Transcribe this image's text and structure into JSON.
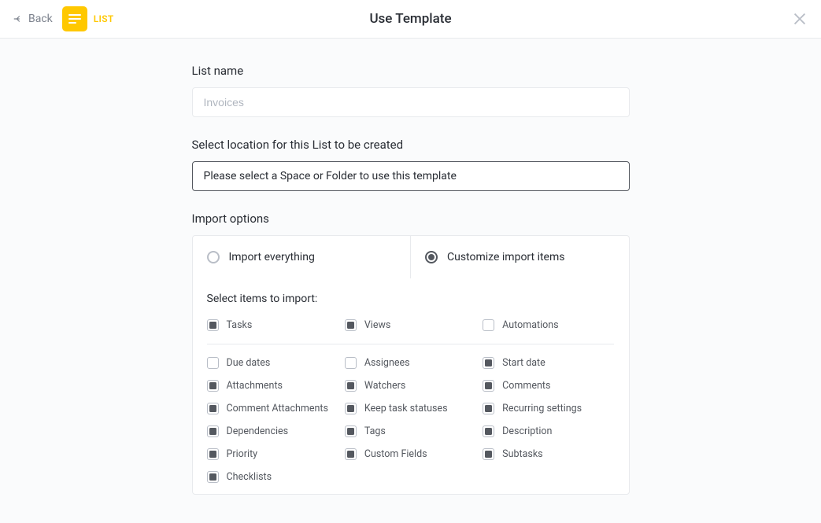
{
  "header": {
    "back_label": "Back",
    "list_label": "LIST",
    "title": "Use Template"
  },
  "list_name": {
    "label": "List name",
    "placeholder": "Invoices",
    "value": ""
  },
  "location": {
    "label": "Select location for this List to be created",
    "placeholder": "Please select a Space or Folder to use this template"
  },
  "import": {
    "label": "Import options",
    "tabs": {
      "everything": "Import everything",
      "customize": "Customize import items"
    },
    "selected_tab": "customize",
    "select_label": "Select items to import:",
    "top_items": [
      {
        "label": "Tasks",
        "checked": true
      },
      {
        "label": "Views",
        "checked": true
      },
      {
        "label": "Automations",
        "checked": false
      }
    ],
    "items": [
      {
        "label": "Due dates",
        "checked": false
      },
      {
        "label": "Assignees",
        "checked": false
      },
      {
        "label": "Start date",
        "checked": true
      },
      {
        "label": "Attachments",
        "checked": true
      },
      {
        "label": "Watchers",
        "checked": true
      },
      {
        "label": "Comments",
        "checked": true
      },
      {
        "label": "Comment Attachments",
        "checked": true
      },
      {
        "label": "Keep task statuses",
        "checked": true
      },
      {
        "label": "Recurring settings",
        "checked": true
      },
      {
        "label": "Dependencies",
        "checked": true
      },
      {
        "label": "Tags",
        "checked": true
      },
      {
        "label": "Description",
        "checked": true
      },
      {
        "label": "Priority",
        "checked": true
      },
      {
        "label": "Custom Fields",
        "checked": true
      },
      {
        "label": "Subtasks",
        "checked": true
      },
      {
        "label": "Checklists",
        "checked": true
      }
    ]
  }
}
